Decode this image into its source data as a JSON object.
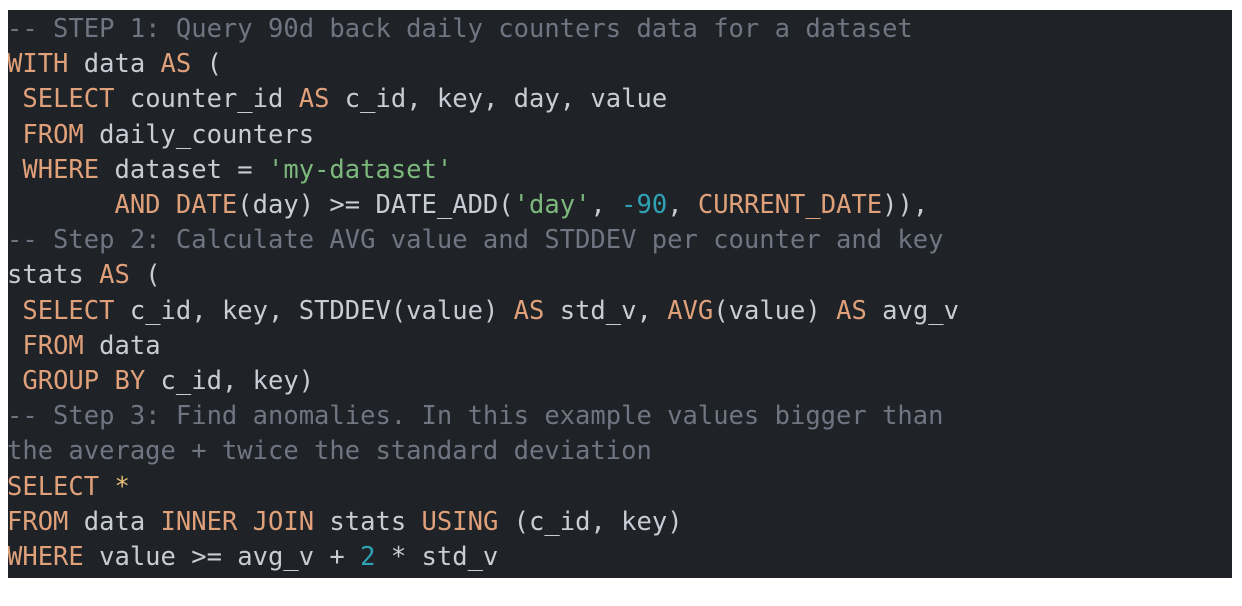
{
  "editor": {
    "language": "sql",
    "background_color": "#1f2227",
    "page_background_color": "#ffffff",
    "token_colors": {
      "comment": "#6f7581",
      "keyword": "#dfa07a",
      "plain": "#c8ccd4",
      "string": "#7cb87c",
      "number": "#2fa3b5",
      "operator": "#e5c07b"
    },
    "plain_text": "-- STEP 1: Query 90d back daily counters data for a dataset\nWITH data AS (\n SELECT counter_id AS c_id, key, day, value\n FROM daily_counters\n WHERE dataset = 'my-dataset'\n       AND DATE(day) >= DATE_ADD('day', -90, CURRENT_DATE)),\n-- Step 2: Calculate AVG value and STDDEV per counter and key\nstats AS (\n SELECT c_id, key, STDDEV(value) AS std_v, AVG(value) AS avg_v\n FROM data\n GROUP BY c_id, key)\n-- Step 3: Find anomalies. In this example values bigger than\nthe average + twice the standard deviation\nSELECT *\nFROM data INNER JOIN stats USING (c_id, key)\nWHERE value >= avg_v + 2 * std_v",
    "lines": [
      {
        "id": 1,
        "tokens": [
          {
            "t": "-- STEP 1: Query 90d back daily counters data for a dataset",
            "k": "comment"
          }
        ]
      },
      {
        "id": 2,
        "tokens": [
          {
            "t": "WITH",
            "k": "keyword"
          },
          {
            "t": " data ",
            "k": "plain"
          },
          {
            "t": "AS",
            "k": "keyword"
          },
          {
            "t": " (",
            "k": "plain"
          }
        ]
      },
      {
        "id": 3,
        "tokens": [
          {
            "t": " ",
            "k": "plain"
          },
          {
            "t": "SELECT",
            "k": "keyword"
          },
          {
            "t": " counter_id ",
            "k": "plain"
          },
          {
            "t": "AS",
            "k": "keyword"
          },
          {
            "t": " c_id, key, day, value",
            "k": "plain"
          }
        ]
      },
      {
        "id": 4,
        "tokens": [
          {
            "t": " ",
            "k": "plain"
          },
          {
            "t": "FROM",
            "k": "keyword"
          },
          {
            "t": " daily_counters",
            "k": "plain"
          }
        ]
      },
      {
        "id": 5,
        "tokens": [
          {
            "t": " ",
            "k": "plain"
          },
          {
            "t": "WHERE",
            "k": "keyword"
          },
          {
            "t": " dataset = ",
            "k": "plain"
          },
          {
            "t": "'my-dataset'",
            "k": "string"
          }
        ]
      },
      {
        "id": 6,
        "tokens": [
          {
            "t": "       ",
            "k": "plain"
          },
          {
            "t": "AND DATE",
            "k": "keyword"
          },
          {
            "t": "(day) >= ",
            "k": "plain"
          },
          {
            "t": "DATE_ADD",
            "k": "plain"
          },
          {
            "t": "(",
            "k": "plain"
          },
          {
            "t": "'day'",
            "k": "string"
          },
          {
            "t": ", ",
            "k": "plain"
          },
          {
            "t": "-90",
            "k": "number"
          },
          {
            "t": ", ",
            "k": "plain"
          },
          {
            "t": "CURRENT_DATE",
            "k": "keyword"
          },
          {
            "t": ")),",
            "k": "plain"
          }
        ]
      },
      {
        "id": 7,
        "tokens": [
          {
            "t": "-- Step 2: Calculate AVG value and STDDEV per counter and key",
            "k": "comment"
          }
        ]
      },
      {
        "id": 8,
        "tokens": [
          {
            "t": "stats ",
            "k": "plain"
          },
          {
            "t": "AS",
            "k": "keyword"
          },
          {
            "t": " (",
            "k": "plain"
          }
        ]
      },
      {
        "id": 9,
        "tokens": [
          {
            "t": " ",
            "k": "plain"
          },
          {
            "t": "SELECT",
            "k": "keyword"
          },
          {
            "t": " c_id, key, STDDEV(value) ",
            "k": "plain"
          },
          {
            "t": "AS",
            "k": "keyword"
          },
          {
            "t": " std_v, ",
            "k": "plain"
          },
          {
            "t": "AVG",
            "k": "keyword"
          },
          {
            "t": "(value) ",
            "k": "plain"
          },
          {
            "t": "AS",
            "k": "keyword"
          },
          {
            "t": " avg_v",
            "k": "plain"
          }
        ]
      },
      {
        "id": 10,
        "tokens": [
          {
            "t": " ",
            "k": "plain"
          },
          {
            "t": "FROM",
            "k": "keyword"
          },
          {
            "t": " data",
            "k": "plain"
          }
        ]
      },
      {
        "id": 11,
        "tokens": [
          {
            "t": " ",
            "k": "plain"
          },
          {
            "t": "GROUP BY",
            "k": "keyword"
          },
          {
            "t": " c_id, key)",
            "k": "plain"
          }
        ]
      },
      {
        "id": 12,
        "tokens": [
          {
            "t": "-- Step 3: Find anomalies. In this example values bigger than",
            "k": "comment"
          }
        ]
      },
      {
        "id": 13,
        "tokens": [
          {
            "t": "the average + twice the standard deviation",
            "k": "comment"
          }
        ]
      },
      {
        "id": 14,
        "tokens": [
          {
            "t": "SELECT",
            "k": "keyword"
          },
          {
            "t": " ",
            "k": "plain"
          },
          {
            "t": "*",
            "k": "operator"
          }
        ]
      },
      {
        "id": 15,
        "tokens": [
          {
            "t": "FROM",
            "k": "keyword"
          },
          {
            "t": " data ",
            "k": "plain"
          },
          {
            "t": "INNER JOIN",
            "k": "keyword"
          },
          {
            "t": " stats ",
            "k": "plain"
          },
          {
            "t": "USING",
            "k": "keyword"
          },
          {
            "t": " (c_id, key)",
            "k": "plain"
          }
        ]
      },
      {
        "id": 16,
        "tokens": [
          {
            "t": "WHERE",
            "k": "keyword"
          },
          {
            "t": " value >= avg_v + ",
            "k": "plain"
          },
          {
            "t": "2",
            "k": "number"
          },
          {
            "t": " * std_v",
            "k": "plain"
          }
        ]
      }
    ]
  }
}
